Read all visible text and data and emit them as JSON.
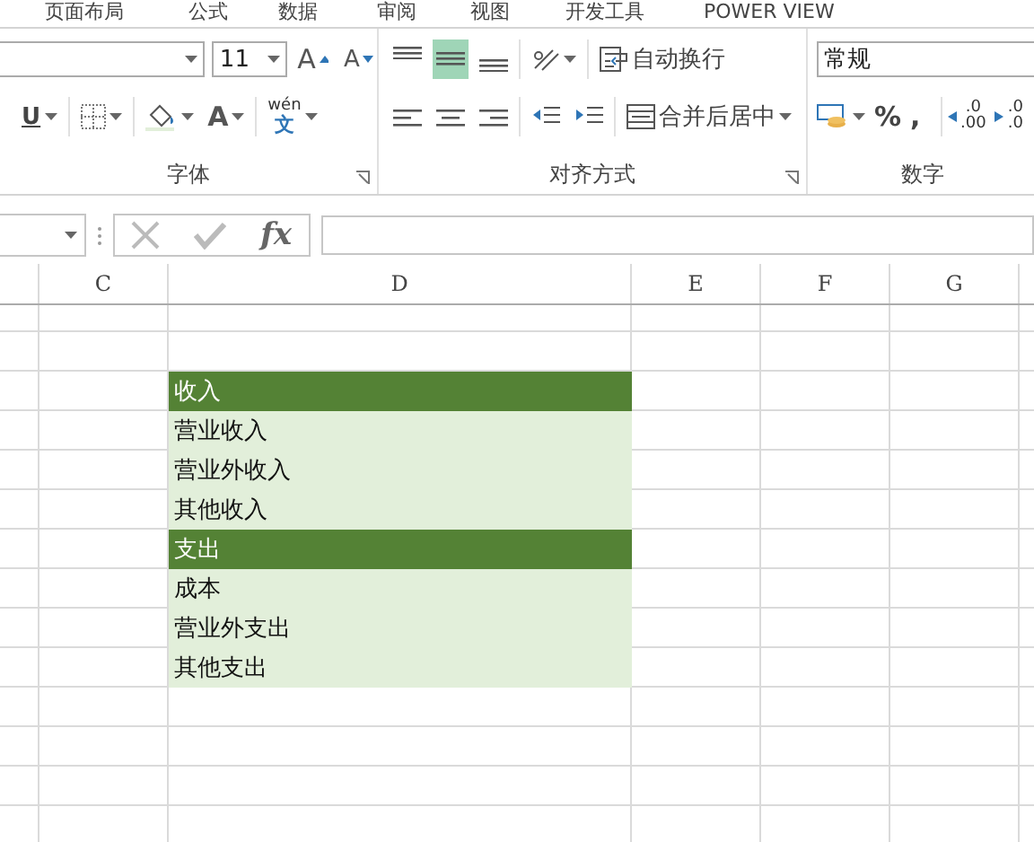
{
  "tabs": [
    "页面布局",
    "公式",
    "数据",
    "审阅",
    "视图",
    "开发工具",
    "POWER VIEW"
  ],
  "font_group": {
    "label": "字体",
    "font_size": "11",
    "grow": "A",
    "shrink": "A",
    "underline": "U",
    "font_color": "A",
    "phonetic_top": "wén",
    "phonetic_bottom": "文"
  },
  "alignment_group": {
    "label": "对齐方式",
    "vertical": [
      {
        "selected": false
      },
      {
        "selected": true
      },
      {
        "selected": false
      }
    ],
    "wrap": "自动换行",
    "merge": "合并后居中"
  },
  "number_group": {
    "label": "数字",
    "format": "常规",
    "percent": "%",
    "comma": ",",
    "decimals": [
      {
        "top": ".0",
        "bottom": ".00"
      },
      {
        "top": ".0",
        "bottom": ".0"
      }
    ]
  },
  "formula_bar": {
    "fx": "fx"
  },
  "sheet": {
    "columns": [
      "C",
      "D",
      "E",
      "F",
      "G"
    ],
    "cells": [
      {
        "text": "收入",
        "kind": "header"
      },
      {
        "text": "营业收入",
        "kind": "item"
      },
      {
        "text": "营业外收入",
        "kind": "item"
      },
      {
        "text": "其他收入",
        "kind": "item"
      },
      {
        "text": "支出",
        "kind": "header"
      },
      {
        "text": "成本",
        "kind": "item"
      },
      {
        "text": "营业外支出",
        "kind": "item"
      },
      {
        "text": "其他支出",
        "kind": "item"
      }
    ]
  }
}
